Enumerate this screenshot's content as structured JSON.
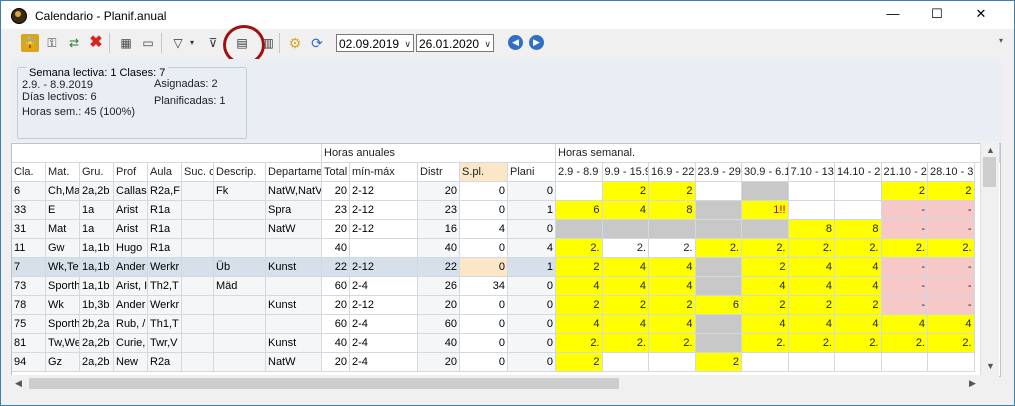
{
  "window": {
    "title": "Calendario - Planif.anual",
    "minimize": "—",
    "maximize": "☐",
    "close": "✕"
  },
  "toolbar": {
    "date_from": "02.09.2019",
    "date_to": "26.01.2020"
  },
  "info": {
    "group_title": "Semana lectiva: 1  Clases: 7",
    "range": "2.9. - 8.9.2019",
    "days": "Días lectivos: 6",
    "hours": "Horas sem.: 45 (100%)",
    "assigned": "Asignadas: 2",
    "planned": "Planificadas: 1"
  },
  "grid": {
    "group_headers": [
      "Horas anuales",
      "Horas semanal."
    ],
    "columns": [
      "Cla.",
      "Mat.",
      "Gru.",
      "Prof",
      "Aula",
      "Suc. cl",
      "Descrip.",
      "Departame",
      "Total",
      "mín-máx",
      "Distr",
      "S.pl.",
      "Plani"
    ],
    "weeks": [
      "2.9 - 8.9",
      "9.9 - 15.9",
      "16.9 - 22",
      "23.9 - 29",
      "30.9 - 6.1",
      "7.10 - 13",
      "14.10 - 2",
      "21.10 - 2",
      "28.10 - 3"
    ],
    "rows": [
      {
        "cells": [
          "6",
          "Ch,Ma",
          "2a,2b",
          "Callas",
          "R2a,F",
          "",
          "Fk",
          "NatW,NatV",
          "20",
          "2-12",
          "20",
          "0",
          "0"
        ],
        "w": [
          "",
          "2",
          "2",
          "",
          "",
          "",
          "",
          "2",
          "2"
        ],
        "wc": [
          "w",
          "y",
          "y",
          "w",
          "g",
          "w",
          "w",
          "y",
          "y"
        ]
      },
      {
        "cells": [
          "33",
          "E",
          "1a",
          "Arist",
          "R1a",
          "",
          "",
          "Spra",
          "23",
          "2-12",
          "23",
          "0",
          "1"
        ],
        "w": [
          "6",
          "4",
          "8",
          "",
          "1!!",
          "",
          "",
          "-",
          "-"
        ],
        "wc": [
          "y",
          "y",
          "y",
          "g",
          "y",
          "w",
          "w",
          "p",
          "p"
        ]
      },
      {
        "cells": [
          "31",
          "Mat",
          "1a",
          "Arist",
          "R1a",
          "",
          "",
          "NatW",
          "20",
          "2-12",
          "16",
          "4",
          "0"
        ],
        "w": [
          "",
          "",
          "",
          "",
          "",
          "8",
          "8",
          "-",
          "-"
        ],
        "wc": [
          "g",
          "g",
          "g",
          "g",
          "g",
          "y",
          "y",
          "p",
          "p"
        ]
      },
      {
        "cells": [
          "11",
          "Gw",
          "1a,1b",
          "Hugo",
          "R1a",
          "",
          "",
          "",
          "40",
          "",
          "40",
          "0",
          "4"
        ],
        "w": [
          "2.",
          "2.",
          "2.",
          "2.",
          "2.",
          "2.",
          "2.",
          "2.",
          "2."
        ],
        "wc": [
          "y",
          "w",
          "w",
          "y",
          "y",
          "y",
          "y",
          "y",
          "y"
        ]
      },
      {
        "cells": [
          "7",
          "Wk,Te",
          "1a,1b",
          "Ander",
          "Werkr",
          "",
          "Üb",
          "Kunst",
          "22",
          "2-12",
          "22",
          "0",
          "1"
        ],
        "w": [
          "2",
          "4",
          "4",
          "",
          "2",
          "4",
          "4",
          "-",
          "-"
        ],
        "wc": [
          "y",
          "y",
          "y",
          "g",
          "y",
          "y",
          "y",
          "p",
          "p"
        ]
      },
      {
        "cells": [
          "73",
          "Sporth",
          "1a,1b",
          "Arist, I",
          "Th2,T",
          "",
          "Mäd",
          "",
          "60",
          "2-4",
          "26",
          "34",
          "0"
        ],
        "w": [
          "4",
          "4",
          "4",
          "",
          "4",
          "4",
          "4",
          "-",
          "-"
        ],
        "wc": [
          "y",
          "y",
          "y",
          "g",
          "y",
          "y",
          "y",
          "p",
          "p"
        ]
      },
      {
        "cells": [
          "78",
          "Wk",
          "1b,3b",
          "Ander",
          "Werkr",
          "",
          "",
          "Kunst",
          "20",
          "2-12",
          "20",
          "0",
          "0"
        ],
        "w": [
          "2",
          "2",
          "2",
          "6",
          "2",
          "2",
          "2",
          "-",
          "-"
        ],
        "wc": [
          "y",
          "y",
          "y",
          "y",
          "y",
          "y",
          "y",
          "p",
          "p"
        ]
      },
      {
        "cells": [
          "75",
          "Sporth",
          "2b,2a",
          "Rub, /",
          "Th1,T",
          "",
          "",
          "",
          "60",
          "2-4",
          "60",
          "0",
          "0"
        ],
        "w": [
          "4",
          "4",
          "4",
          "",
          "4",
          "4",
          "4",
          "4",
          "4"
        ],
        "wc": [
          "y",
          "y",
          "y",
          "g",
          "y",
          "y",
          "y",
          "y",
          "y"
        ]
      },
      {
        "cells": [
          "81",
          "Tw,We",
          "2a,2b",
          "Curie,",
          "Twr,V",
          "",
          "",
          "Kunst",
          "40",
          "2-4",
          "40",
          "0",
          "0"
        ],
        "w": [
          "2.",
          "2.",
          "2.",
          "",
          "2.",
          "2.",
          "2.",
          "2.",
          "2."
        ],
        "wc": [
          "y",
          "y",
          "y",
          "g",
          "y",
          "y",
          "y",
          "y",
          "y"
        ]
      },
      {
        "cells": [
          "94",
          "Gz",
          "2a,2b",
          "New",
          "R2a",
          "",
          "",
          "NatW",
          "20",
          "2-4",
          "20",
          "0",
          "0"
        ],
        "w": [
          "2",
          "",
          "",
          "2",
          "",
          "",
          "",
          "",
          ""
        ],
        "wc": [
          "y",
          "w",
          "w",
          "y",
          "w",
          "w",
          "w",
          "w",
          "w"
        ]
      }
    ]
  },
  "colors": {
    "yellow": "#ffff00",
    "gray": "#c8c8c8",
    "pink": "#f6c8c8",
    "selected_row": "#d6e0ea",
    "accent": "#2f6fc4"
  }
}
